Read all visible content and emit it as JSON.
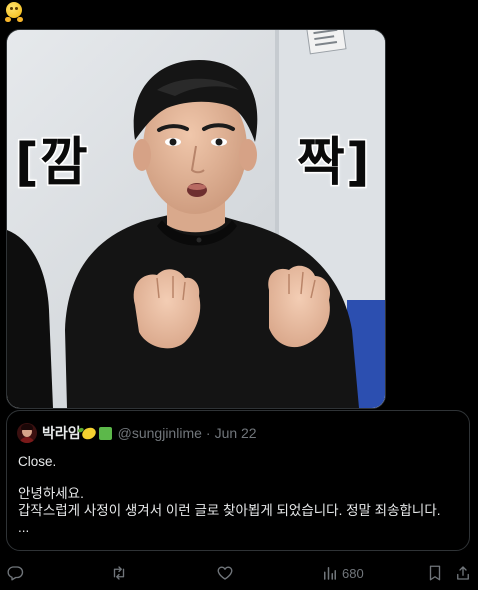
{
  "top_emoji": "hugging-face-emoji",
  "media": {
    "caption_left": "[깜",
    "caption_right": "짝]",
    "description_icon": "photo"
  },
  "quote": {
    "name": "박라임",
    "handle": "@sungjinlime",
    "separator": "·",
    "date": "Jun 22",
    "lines": [
      "Close.",
      "",
      "안녕하세요.",
      "갑작스럽게 사정이 생겨서 이런 글로 찾아뵙게 되었습니다.  정말 죄송합니다.",
      "..."
    ]
  },
  "actions": {
    "reply_icon": "reply-icon",
    "repost_icon": "repost-icon",
    "like_icon": "like-icon",
    "views_icon": "views-icon",
    "views_count": "680",
    "bookmark_icon": "bookmark-icon",
    "share_icon": "share-icon"
  },
  "colors": {
    "background": "#000000",
    "text": "#e7e9ea",
    "muted": "#71767b",
    "border": "#2f3336"
  }
}
